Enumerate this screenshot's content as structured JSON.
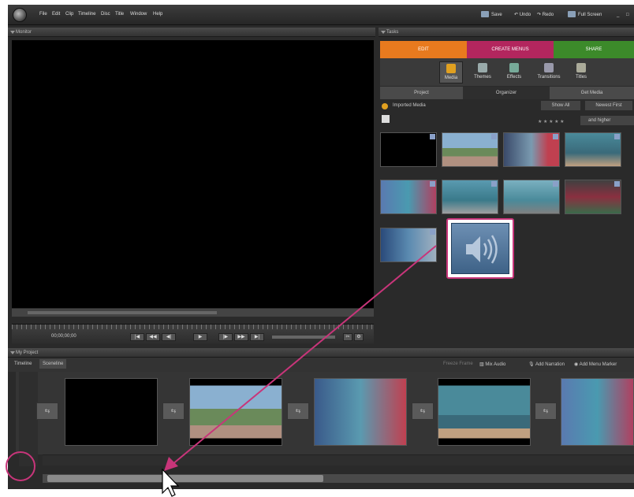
{
  "menubar": {
    "items": [
      "File",
      "Edit",
      "Clip",
      "Timeline",
      "Disc",
      "Title",
      "Window",
      "Help"
    ],
    "save_label": "Save",
    "undo_label": "Undo",
    "redo_label": "Redo",
    "fullscreen_label": "Full Screen"
  },
  "monitor": {
    "header": "Monitor",
    "timecode": "00;00;00;00"
  },
  "tasks": {
    "header": "Tasks",
    "tabs": [
      {
        "label": "EDIT",
        "color": "#e87a1e"
      },
      {
        "label": "CREATE MENUS",
        "color": "#b3265e"
      },
      {
        "label": "SHARE",
        "color": "#3c8a2a"
      }
    ],
    "tools": [
      "Media",
      "Themes",
      "Effects",
      "Transitions",
      "Titles"
    ],
    "subtabs": [
      "Project",
      "Organizer",
      "Get Media"
    ],
    "imported_media": "Imported Media",
    "show_all": "Show All",
    "sort": "Newest First",
    "rating": "and higher"
  },
  "project": {
    "header": "My Project",
    "view_tabs": [
      "Timeline",
      "Sceneline"
    ],
    "tools": [
      "Freeze Frame",
      "Mix Audio",
      "Add Narration",
      "Add Menu Marker"
    ]
  },
  "icons": {
    "audio": "speaker-icon",
    "transition": "transition-icon"
  },
  "colors": {
    "highlight": "#c8357a"
  }
}
